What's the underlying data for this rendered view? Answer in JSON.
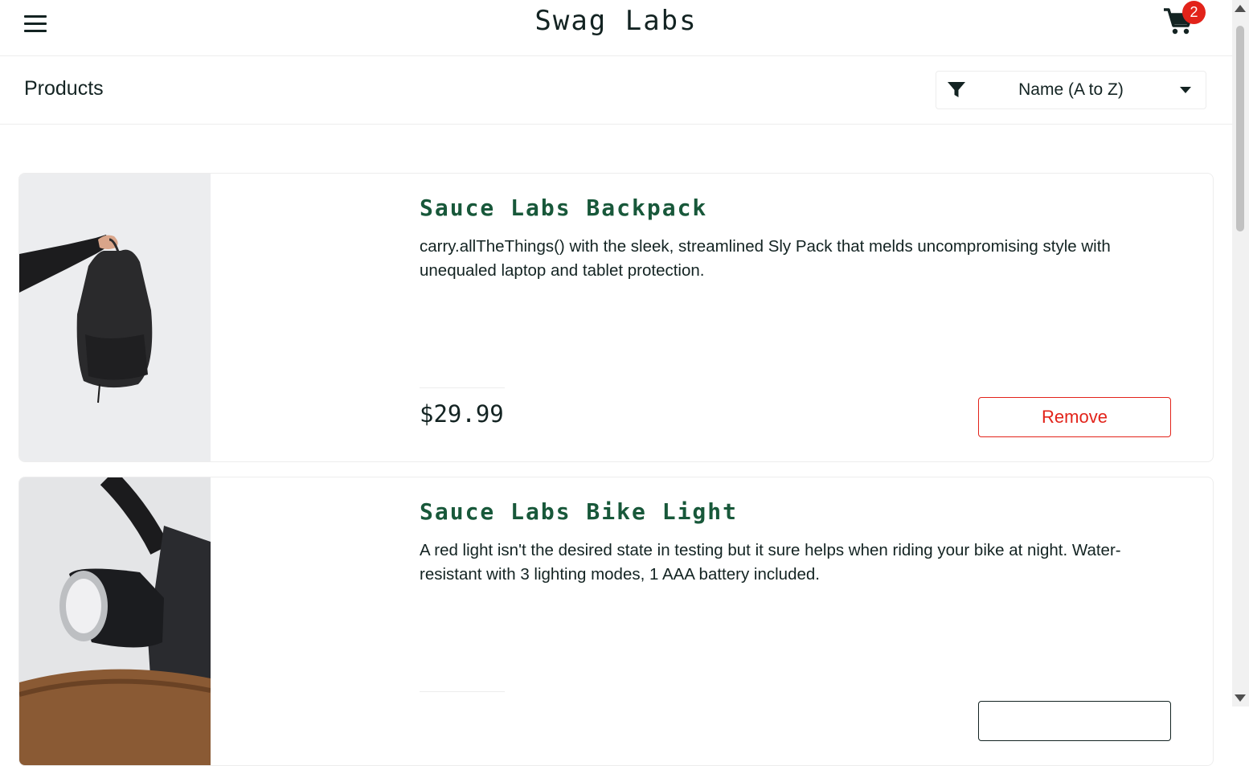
{
  "header": {
    "title": "Swag Labs",
    "cart_count": "2"
  },
  "subheader": {
    "title": "Products",
    "sort_selected": "Name (A to Z)"
  },
  "products": [
    {
      "name": "Sauce Labs Backpack",
      "description": "carry.allTheThings() with the sleek, streamlined Sly Pack that melds uncompromising style with unequaled laptop and tablet protection.",
      "price": "$29.99",
      "button_label": "Remove"
    },
    {
      "name": "Sauce Labs Bike Light",
      "description": "A red light isn't the desired state in testing but it sure helps when riding your bike at night. Water-resistant with 3 lighting modes, 1 AAA battery included.",
      "button_label": ""
    }
  ],
  "colors": {
    "accent_red": "#e2231a",
    "product_name_green": "#18583a",
    "text_dark": "#132322"
  },
  "icons": {
    "menu": "hamburger-menu-icon",
    "cart": "shopping-cart-icon",
    "sort": "filter-icon"
  }
}
